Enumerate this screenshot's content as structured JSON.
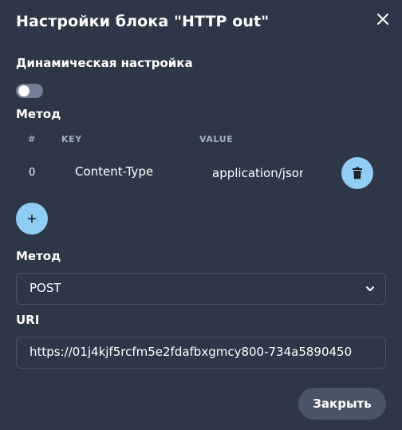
{
  "dialog": {
    "title": "Настройки блока \"HTTP out\"",
    "dynamic_label": "Динамическая настройка",
    "dynamic_enabled": false,
    "headers_label": "Метод",
    "headers_table": {
      "columns": [
        "#",
        "KEY",
        "VALUE"
      ],
      "rows": [
        {
          "index": "0",
          "key": "Content-Type",
          "value": "application/json"
        }
      ]
    },
    "method_label": "Метод",
    "method_value": "POST",
    "uri_label": "URI",
    "uri_value": "https://01j4kjf5rcfm5e2fdafbxgmcy800-734a5890450",
    "close_button": "Закрыть"
  },
  "icons": {
    "close": "close-icon",
    "delete": "trash-icon",
    "add": "plus-icon",
    "select": "chevron-down-icon"
  },
  "colors": {
    "background": "#2d3748",
    "accent_button": "#90cdf4",
    "secondary_button": "#4a5568",
    "toggle_off": "#718096",
    "border": "#4a5568",
    "header_text": "#a0aec0"
  }
}
